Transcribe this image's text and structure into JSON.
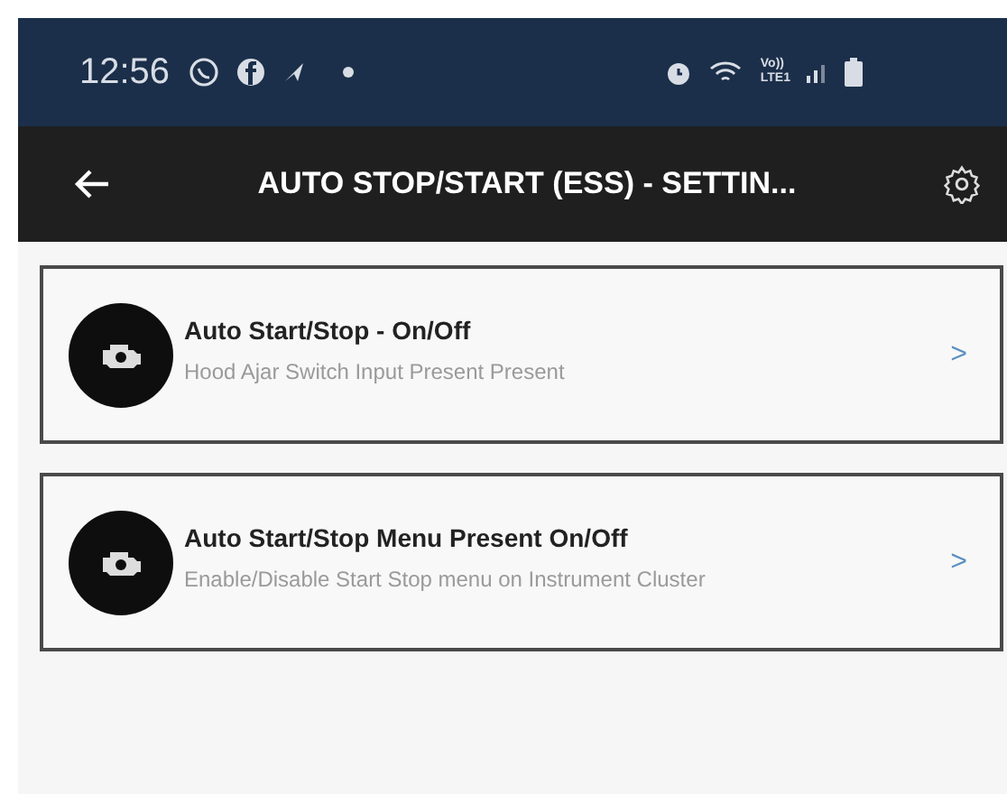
{
  "status_bar": {
    "time": "12:56",
    "network_top": "Vo))",
    "network_bottom": "LTE1"
  },
  "app_bar": {
    "title": "AUTO STOP/START (ESS) - SETTIN..."
  },
  "settings": [
    {
      "title": "Auto Start/Stop - On/Off",
      "subtitle": "Hood Ajar Switch Input Present Present",
      "chevron": ">"
    },
    {
      "title": "Auto Start/Stop Menu Present On/Off",
      "subtitle": "Enable/Disable Start Stop menu on Instrument Cluster",
      "chevron": ">"
    }
  ]
}
